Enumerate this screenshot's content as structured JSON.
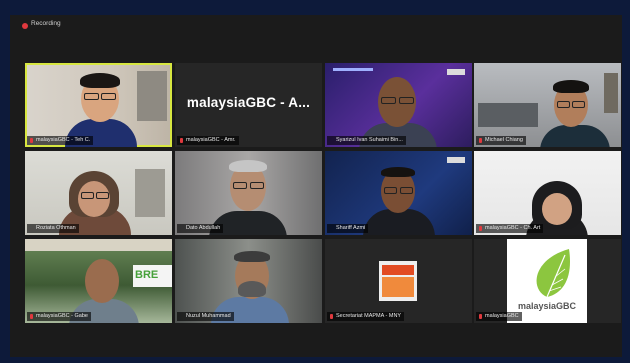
{
  "recording": {
    "label": "Recording"
  },
  "tiles": [
    {
      "name": "malaysiaGBC - Teh C.",
      "muted": true
    },
    {
      "name": "malaysiaGBC - Amr.",
      "muted": true,
      "display_text": "malaysiaGBC - A..."
    },
    {
      "name": "Syarizul Ivan Suhaimi Bin...",
      "muted": false
    },
    {
      "name": "Michael Chiang",
      "muted": true
    },
    {
      "name": "Roziata Othman",
      "muted": false
    },
    {
      "name": "Dato Abdullah",
      "muted": false
    },
    {
      "name": "Shariff Azmi",
      "muted": false
    },
    {
      "name": "malaysiaGBC - Ch. Art",
      "muted": true
    },
    {
      "name": "malaysiaGBC - Gabe",
      "muted": true
    },
    {
      "name": "Nuzul Muhammad",
      "muted": false
    },
    {
      "name": "Secretariat MAPMA - MNY",
      "muted": true
    },
    {
      "name": "malaysiaGBC",
      "muted": true
    }
  ],
  "logo": {
    "text": "malaysiaGBC"
  },
  "banner_text": "BRE",
  "colors": {
    "active_border": "#d7e640",
    "muted_mic": "#e0393e",
    "background": "#0d1a3a"
  }
}
